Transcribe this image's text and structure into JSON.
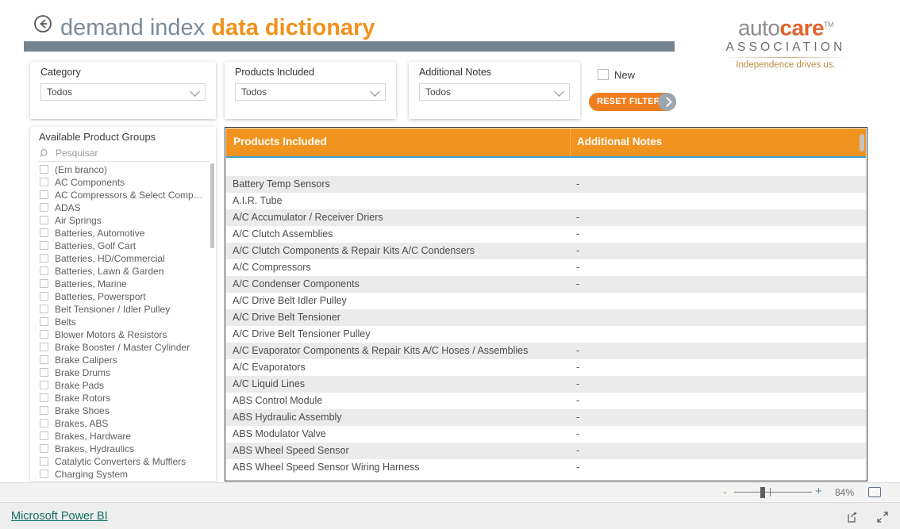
{
  "header": {
    "back_icon": "back-arrow-circle-icon",
    "title_part1": "demand index ",
    "title_part2": "data dictionary",
    "accent_color": "#f2911b",
    "rule_color": "#75838f"
  },
  "logo": {
    "word_a": "auto",
    "word_b": "care",
    "trademark": "TM",
    "association": "ASSOCIATION",
    "tagline": "Independence drives us.",
    "gray": "#8d8d8d",
    "orange": "#e2622b",
    "tagline_color": "#c08a3e"
  },
  "filters": [
    {
      "label": "Category",
      "value": "Todos",
      "chevron_icon": "chevron-down-icon"
    },
    {
      "label": "Products Included",
      "value": "Todos",
      "chevron_icon": "chevron-down-icon"
    },
    {
      "label": "Additional Notes",
      "value": "Todos",
      "chevron_icon": "chevron-down-icon"
    }
  ],
  "new_filter": {
    "label": "New",
    "checked": false
  },
  "reset_button": {
    "label": "RESET FILTERS",
    "arrow_icon": "chevron-right-icon",
    "bg_color": "#f07e1e",
    "circle_color": "#9aa5ae"
  },
  "slicer": {
    "title": "Available Product Groups",
    "search_icon": "search-icon",
    "search_placeholder": "Pesquisar",
    "items": [
      {
        "label": "(Em branco)",
        "checked": false
      },
      {
        "label": "AC Components",
        "checked": false
      },
      {
        "label": "AC Compressors & Select Compone...",
        "checked": false
      },
      {
        "label": "ADAS",
        "checked": false
      },
      {
        "label": "Air Springs",
        "checked": false
      },
      {
        "label": "Batteries, Automotive",
        "checked": false
      },
      {
        "label": "Batteries, Golf Cart",
        "checked": false
      },
      {
        "label": "Batteries, HD/Commercial",
        "checked": false
      },
      {
        "label": "Batteries, Lawn & Garden",
        "checked": false
      },
      {
        "label": "Batteries, Marine",
        "checked": false
      },
      {
        "label": "Batteries, Powersport",
        "checked": false
      },
      {
        "label": "Belt Tensioner / Idler Pulley",
        "checked": false
      },
      {
        "label": "Belts",
        "checked": false
      },
      {
        "label": "Blower Motors & Resistors",
        "checked": false
      },
      {
        "label": "Brake Booster /  Master Cylinder",
        "checked": false
      },
      {
        "label": "Brake Calipers",
        "checked": false
      },
      {
        "label": "Brake Drums",
        "checked": false
      },
      {
        "label": "Brake Pads",
        "checked": false
      },
      {
        "label": "Brake Rotors",
        "checked": false
      },
      {
        "label": "Brake Shoes",
        "checked": false
      },
      {
        "label": "Brakes, ABS",
        "checked": false
      },
      {
        "label": "Brakes, Hardware",
        "checked": false
      },
      {
        "label": "Brakes, Hydraulics",
        "checked": false
      },
      {
        "label": "Catalytic Converters & Mufflers",
        "checked": false
      },
      {
        "label": "Charging System",
        "checked": false
      }
    ]
  },
  "table": {
    "header_bg": "#f0941f",
    "accent_line": "#3da0d8",
    "columns": [
      "Products Included",
      "Additional Notes"
    ],
    "rows": [
      {
        "product": "",
        "notes": ""
      },
      {
        "product": "Battery Temp Sensors",
        "notes": "-"
      },
      {
        "product": "A.I.R. Tube",
        "notes": ""
      },
      {
        "product": "A/C Accumulator / Receiver Driers",
        "notes": "-"
      },
      {
        "product": "A/C Clutch Assemblies",
        "notes": "-"
      },
      {
        "product": "A/C Clutch Components & Repair Kits A/C Condensers",
        "notes": "-"
      },
      {
        "product": "A/C Compressors",
        "notes": "-"
      },
      {
        "product": "A/C Condenser Components",
        "notes": "-"
      },
      {
        "product": "A/C Drive Belt Idler Pulley",
        "notes": ""
      },
      {
        "product": "A/C Drive Belt Tensioner",
        "notes": ""
      },
      {
        "product": "A/C Drive Belt Tensioner Pulley",
        "notes": ""
      },
      {
        "product": "A/C Evaporator Components & Repair Kits A/C Hoses / Assemblies",
        "notes": "-"
      },
      {
        "product": "A/C Evaporators",
        "notes": "-"
      },
      {
        "product": "A/C Liquid Lines",
        "notes": "-"
      },
      {
        "product": "ABS Control Module",
        "notes": "-"
      },
      {
        "product": "ABS Hydraulic Assembly",
        "notes": "-"
      },
      {
        "product": "ABS Modulator Valve",
        "notes": "-"
      },
      {
        "product": "ABS Wheel Speed Sensor",
        "notes": "-"
      },
      {
        "product": "ABS Wheel Speed Sensor Wiring Harness",
        "notes": "-"
      }
    ]
  },
  "zoombar": {
    "minus_label": "-",
    "plus_label": "+",
    "zoom_level": "84%",
    "fit_icon": "fit-to-screen-icon"
  },
  "footer": {
    "link_label": "Microsoft Power BI",
    "link_color": "#136f63",
    "share_icon": "share-icon",
    "fullscreen_icon": "fullscreen-icon"
  }
}
